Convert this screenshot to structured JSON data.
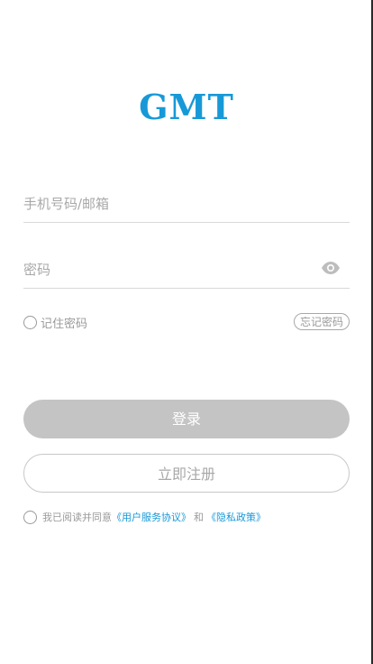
{
  "brand": {
    "logo_text": "GMT",
    "logo_color": "#1799d8"
  },
  "form": {
    "account_placeholder": "手机号码/邮箱",
    "password_placeholder": "密码",
    "password_toggle_icon": "eye-icon",
    "remember_label": "记住密码",
    "remember_checked": false,
    "forgot_label": "忘记密码"
  },
  "actions": {
    "login_label": "登录",
    "login_color": "#c4c4c4",
    "register_label": "立即注册"
  },
  "agreement": {
    "checked": false,
    "prefix": "我已阅读并同意",
    "terms_link": "《用户服务协议》",
    "conjunction": "和",
    "privacy_link": "《隐私政策》",
    "link_color": "#1799d8"
  }
}
